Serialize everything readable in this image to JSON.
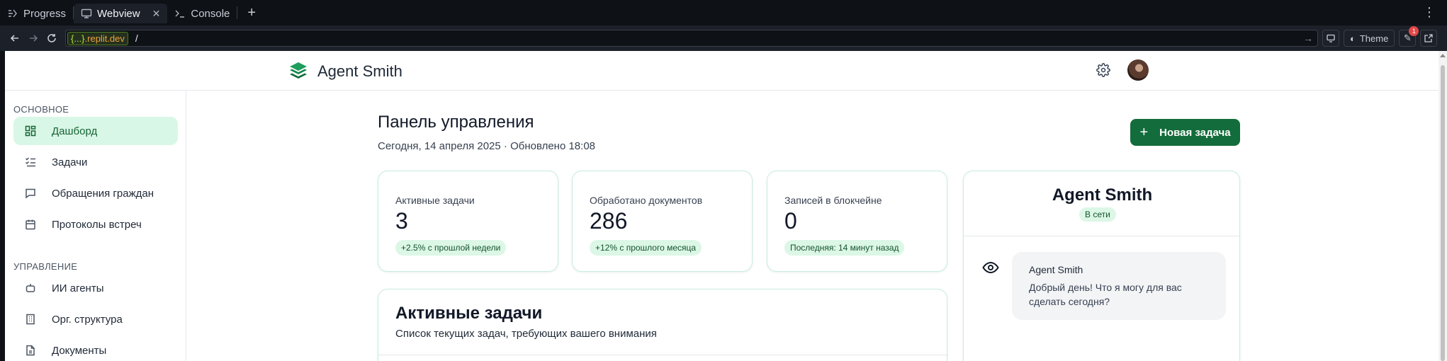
{
  "replit": {
    "tabs": [
      {
        "label": "Progress"
      },
      {
        "label": "Webview"
      },
      {
        "label": "Console"
      }
    ],
    "url": {
      "host_prefix": "{...}",
      "host_domain": ".replit.dev",
      "path": "/"
    },
    "theme_label": "Theme",
    "notification_count": "1"
  },
  "app": {
    "brand": "Agent Smith",
    "sidebar": {
      "section_main": "ОСНОВНОЕ",
      "section_manage": "УПРАВЛЕНИЕ",
      "items": [
        {
          "label": "Дашборд",
          "icon": "dashboard-icon",
          "active": true
        },
        {
          "label": "Задачи",
          "icon": "tasks-icon"
        },
        {
          "label": "Обращения граждан",
          "icon": "message-icon"
        },
        {
          "label": "Протоколы встреч",
          "icon": "calendar-icon"
        },
        {
          "label": "ИИ агенты",
          "icon": "bot-icon"
        },
        {
          "label": "Орг. структура",
          "icon": "building-icon"
        },
        {
          "label": "Документы",
          "icon": "document-icon"
        }
      ]
    },
    "header": {
      "title": "Панель управления",
      "subtitle": "Сегодня, 14 апреля 2025 · Обновлено 18:08",
      "new_task_label": "Новая задача"
    },
    "stats": [
      {
        "label": "Активные задачи",
        "value": "3",
        "badge": "+2.5% с прошлой недели"
      },
      {
        "label": "Обработано документов",
        "value": "286",
        "badge": "+12% с прошлого месяца"
      },
      {
        "label": "Записей в блокчейне",
        "value": "0",
        "badge": "Последняя: 14 минут назад"
      }
    ],
    "active_tasks": {
      "title": "Активные задачи",
      "subtitle": "Список текущих задач, требующих вашего внимания"
    },
    "agent": {
      "name": "Agent Smith",
      "status": "В сети",
      "message_author": "Agent Smith",
      "message_text": "Добрый день! Что я могу для вас сделать сегодня?"
    },
    "colors": {
      "accent": "#136c3b",
      "badge_bg": "#dcf7e6",
      "active_nav_bg": "#d9f7e6"
    }
  }
}
